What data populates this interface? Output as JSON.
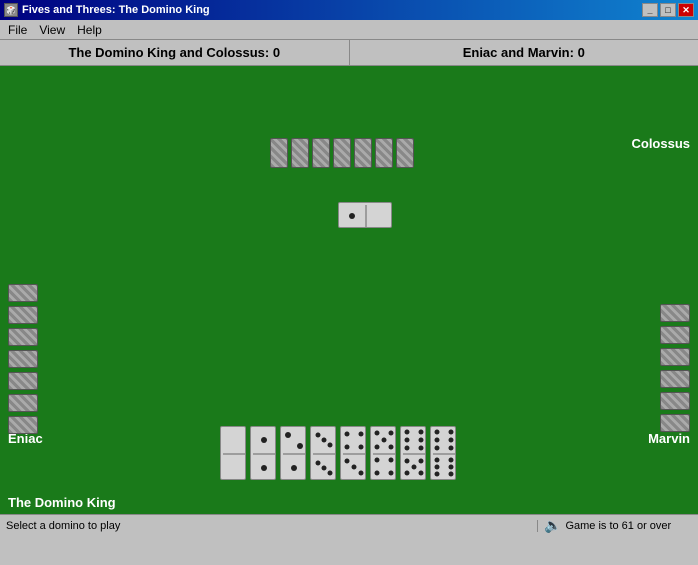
{
  "titleBar": {
    "title": "Fives and Threes: The Domino King",
    "icon": "🎲",
    "buttons": [
      "_",
      "□",
      "×"
    ]
  },
  "menuBar": {
    "items": [
      "File",
      "View",
      "Help"
    ]
  },
  "scores": {
    "left": "The Domino King and Colossus: 0",
    "right": "Eniac and Marvin: 0"
  },
  "players": {
    "top": "Colossus",
    "left": "Eniac",
    "right": "Marvin",
    "bottom": "The Domino King"
  },
  "statusBar": {
    "left": "Select a domino to play",
    "right": "Game is to 61 or over"
  },
  "board": {
    "centerDomino": {
      "left": 1,
      "right": 0
    }
  }
}
